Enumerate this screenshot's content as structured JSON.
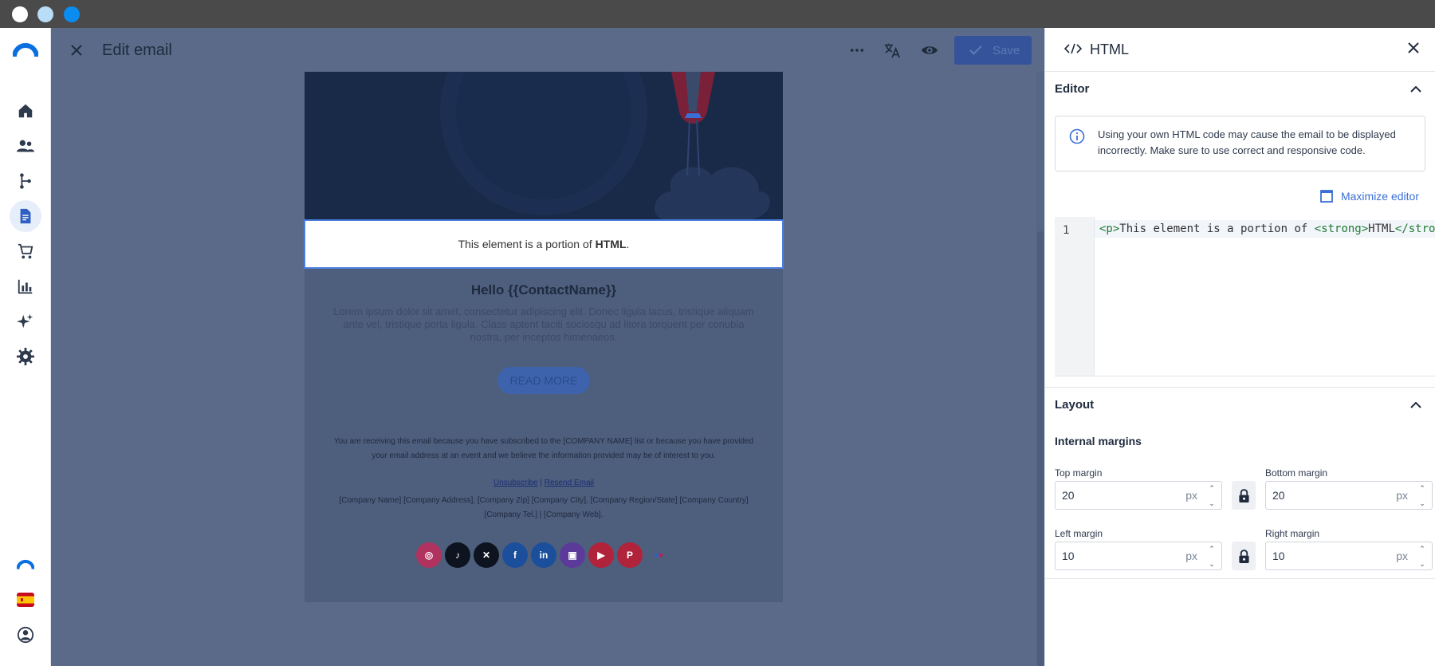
{
  "window": {
    "controls": [
      "close",
      "minimize",
      "maximize"
    ]
  },
  "nav": {
    "items": [
      "home",
      "contacts",
      "automation",
      "email-templates",
      "shop",
      "reports",
      "ai",
      "settings"
    ],
    "active": "email-templates",
    "bottom": [
      "brand",
      "language-es",
      "account"
    ]
  },
  "header": {
    "title": "Edit email",
    "save_label": "Save"
  },
  "email": {
    "html_block_text": "This element is a portion of",
    "html_block_strong": "HTML",
    "html_block_end": ".",
    "hello": "Hello {{ContactName}}",
    "lorem": "Lorem ipsum dolor sit amet, consectetur adipiscing elit. Donec ligula lacus, tristique aliquam ante vel, tristique porta ligula. Class aptent taciti sociosqu ad litora torquent per conubia nostra, per inceptos himenaeos.",
    "read_more": "READ MORE",
    "footer_text": "You are receiving this email because you have subscribed to the [COMPANY NAME] list or because you have provided your email address at an event and we believe the information provided may be of interest to you.",
    "unsubscribe": "Unsubscribe",
    "separator": "|",
    "resend": "Resend Email",
    "address": "[Company Name] [Company Address], [Company Zip] [Company City], [Company Region/State] [Company Country] [Company Tel.] | [Company Web].",
    "socials": [
      {
        "name": "instagram",
        "color": "#b0335f",
        "glyph": "◎"
      },
      {
        "name": "tiktok",
        "color": "#0d1420",
        "glyph": "♪"
      },
      {
        "name": "x",
        "color": "#0d1420",
        "glyph": "✕"
      },
      {
        "name": "facebook",
        "color": "#1b4f9c",
        "glyph": "f"
      },
      {
        "name": "linkedin",
        "color": "#1b4f9c",
        "glyph": "in"
      },
      {
        "name": "twitch",
        "color": "#5b3a9a",
        "glyph": "▣"
      },
      {
        "name": "youtube",
        "color": "#b0233a",
        "glyph": "▶"
      },
      {
        "name": "pinterest",
        "color": "#b0233a",
        "glyph": "P"
      },
      {
        "name": "flickr",
        "color": "transparent",
        "glyph": "●●"
      }
    ]
  },
  "panel": {
    "title": "HTML",
    "editor_label": "Editor",
    "info": "Using your own HTML code may cause the email to be displayed incorrectly. Make sure to use correct and responsive code.",
    "maximize": "Maximize editor",
    "code_line_number": "1",
    "code_p_open": "<p>",
    "code_text": "This element is a portion of ",
    "code_strong_open": "<strong>",
    "code_inner": "HTML",
    "code_strong_close": "</strong>",
    "layout_label": "Layout",
    "internal_margins": "Internal margins",
    "top_margin_label": "Top margin",
    "top_margin": "20",
    "bottom_margin_label": "Bottom margin",
    "bottom_margin": "20",
    "left_margin_label": "Left margin",
    "left_margin": "10",
    "right_margin_label": "Right margin",
    "right_margin": "10",
    "unit": "px"
  }
}
